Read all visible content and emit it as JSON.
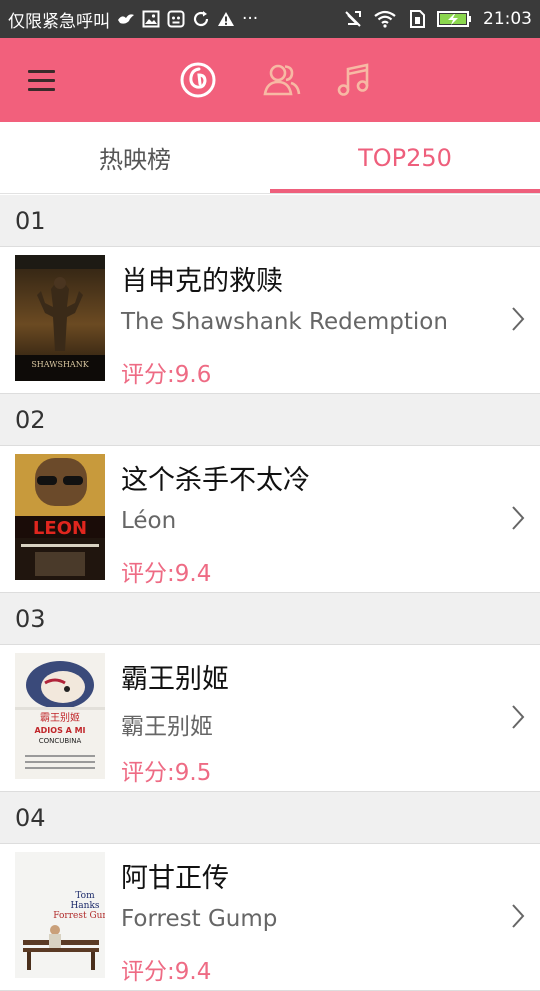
{
  "status_bar": {
    "carrier_text": "仅限紧急呼叫",
    "more_dots": "···",
    "time": "21:03"
  },
  "app_bar": {
    "icons": [
      "menu-icon",
      "netease-music-icon",
      "friends-icon",
      "music-note-icon"
    ],
    "accent": "#f2607c"
  },
  "tabs": [
    {
      "label": "热映榜",
      "active": false
    },
    {
      "label": "TOP250",
      "active": true
    }
  ],
  "movies": [
    {
      "rank": "01",
      "title": "肖申克的救赎",
      "original_title": "The Shawshank Redemption",
      "rating": "评分:9.6",
      "poster_text": "SHAWSHANK"
    },
    {
      "rank": "02",
      "title": "这个杀手不太冷",
      "original_title": "Léon",
      "rating": "评分:9.4",
      "poster_text": "LEON"
    },
    {
      "rank": "03",
      "title": "霸王别姬",
      "original_title": "霸王别姬",
      "rating": "评分:9.5",
      "poster_text": "ADIOS A MI"
    },
    {
      "rank": "04",
      "title": "阿甘正传",
      "original_title": "Forrest Gump",
      "rating": "评分:9.4",
      "poster_text": "Forrest Gump"
    }
  ],
  "colors": {
    "accent_pink": "#ee5f7c",
    "status_bar": "#3a3a3a",
    "rank_header_bg": "#f0f0f0"
  }
}
